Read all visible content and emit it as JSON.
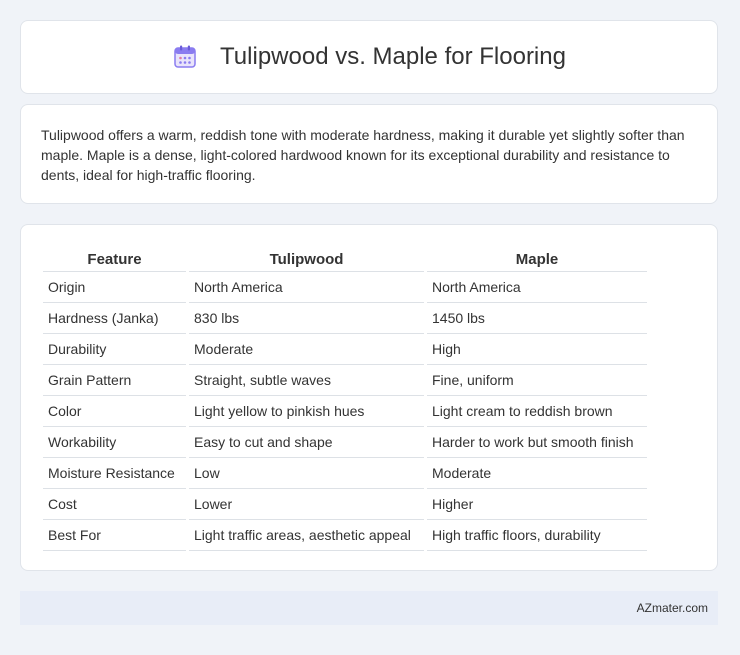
{
  "header": {
    "title": "Tulipwood vs. Maple for Flooring",
    "icon": "calendar-icon"
  },
  "description": "Tulipwood offers a warm, reddish tone with moderate hardness, making it durable yet slightly softer than maple. Maple is a dense, light-colored hardwood known for its exceptional durability and resistance to dents, ideal for high-traffic flooring.",
  "table": {
    "columns": [
      "Feature",
      "Tulipwood",
      "Maple"
    ],
    "rows": [
      [
        "Origin",
        "North America",
        "North America"
      ],
      [
        "Hardness (Janka)",
        "830 lbs",
        "1450 lbs"
      ],
      [
        "Durability",
        "Moderate",
        "High"
      ],
      [
        "Grain Pattern",
        "Straight, subtle waves",
        "Fine, uniform"
      ],
      [
        "Color",
        "Light yellow to pinkish hues",
        "Light cream to reddish brown"
      ],
      [
        "Workability",
        "Easy to cut and shape",
        "Harder to work but smooth finish"
      ],
      [
        "Moisture Resistance",
        "Low",
        "Moderate"
      ],
      [
        "Cost",
        "Lower",
        "Higher"
      ],
      [
        "Best For",
        "Light traffic areas, aesthetic appeal",
        "High traffic floors, durability"
      ]
    ]
  },
  "footer": {
    "brand": "AZmater.com"
  },
  "colors": {
    "background": "#f0f3f8",
    "card": "#ffffff",
    "footer": "#e8edf7",
    "icon_accent": "#8a7cf0"
  }
}
